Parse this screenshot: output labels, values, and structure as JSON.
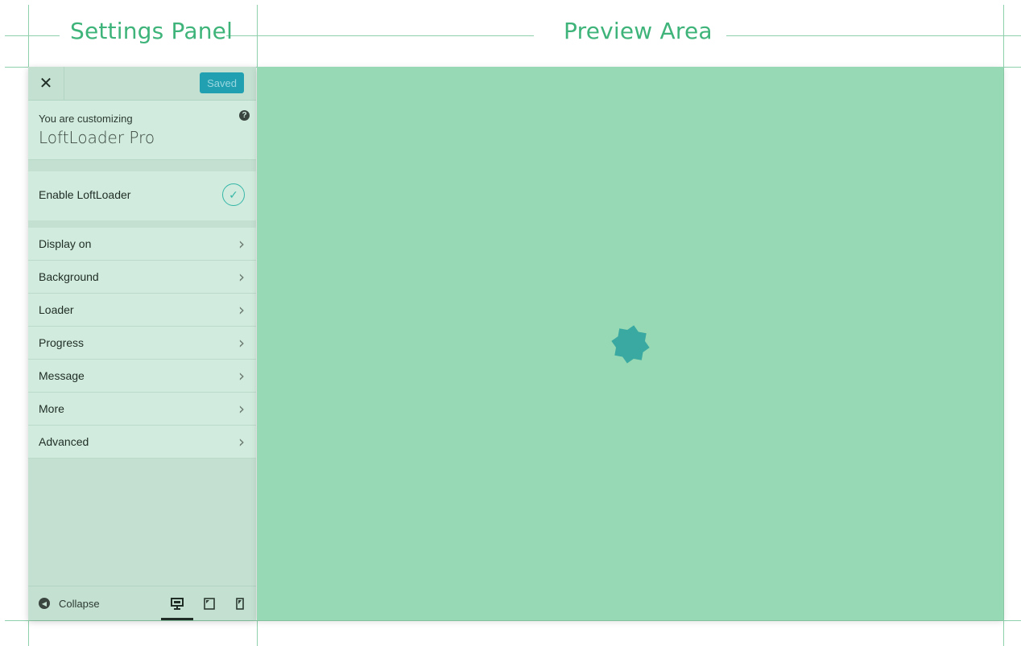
{
  "guides": {
    "settings_label": "Settings Panel",
    "preview_label": "Preview Area"
  },
  "panel": {
    "close_icon": "close-icon",
    "saved_label": "Saved",
    "customizing_label": "You are customizing",
    "theme_name": "LoftLoader Pro",
    "help_icon": "help-icon",
    "enable_label": "Enable LoftLoader",
    "enable_checked": true,
    "menu": [
      {
        "label": "Display on"
      },
      {
        "label": "Background"
      },
      {
        "label": "Loader"
      },
      {
        "label": "Progress"
      },
      {
        "label": "Message"
      },
      {
        "label": "More"
      },
      {
        "label": "Advanced"
      }
    ],
    "collapse_label": "Collapse",
    "devices": [
      "desktop-icon",
      "tablet-icon",
      "mobile-icon"
    ],
    "active_device": "desktop-icon"
  },
  "colors": {
    "accent": "#21a0b2",
    "preview_bg": "#97d9b4",
    "panel_bg": "#c4e0d1",
    "loader": "#3aa9a1"
  }
}
